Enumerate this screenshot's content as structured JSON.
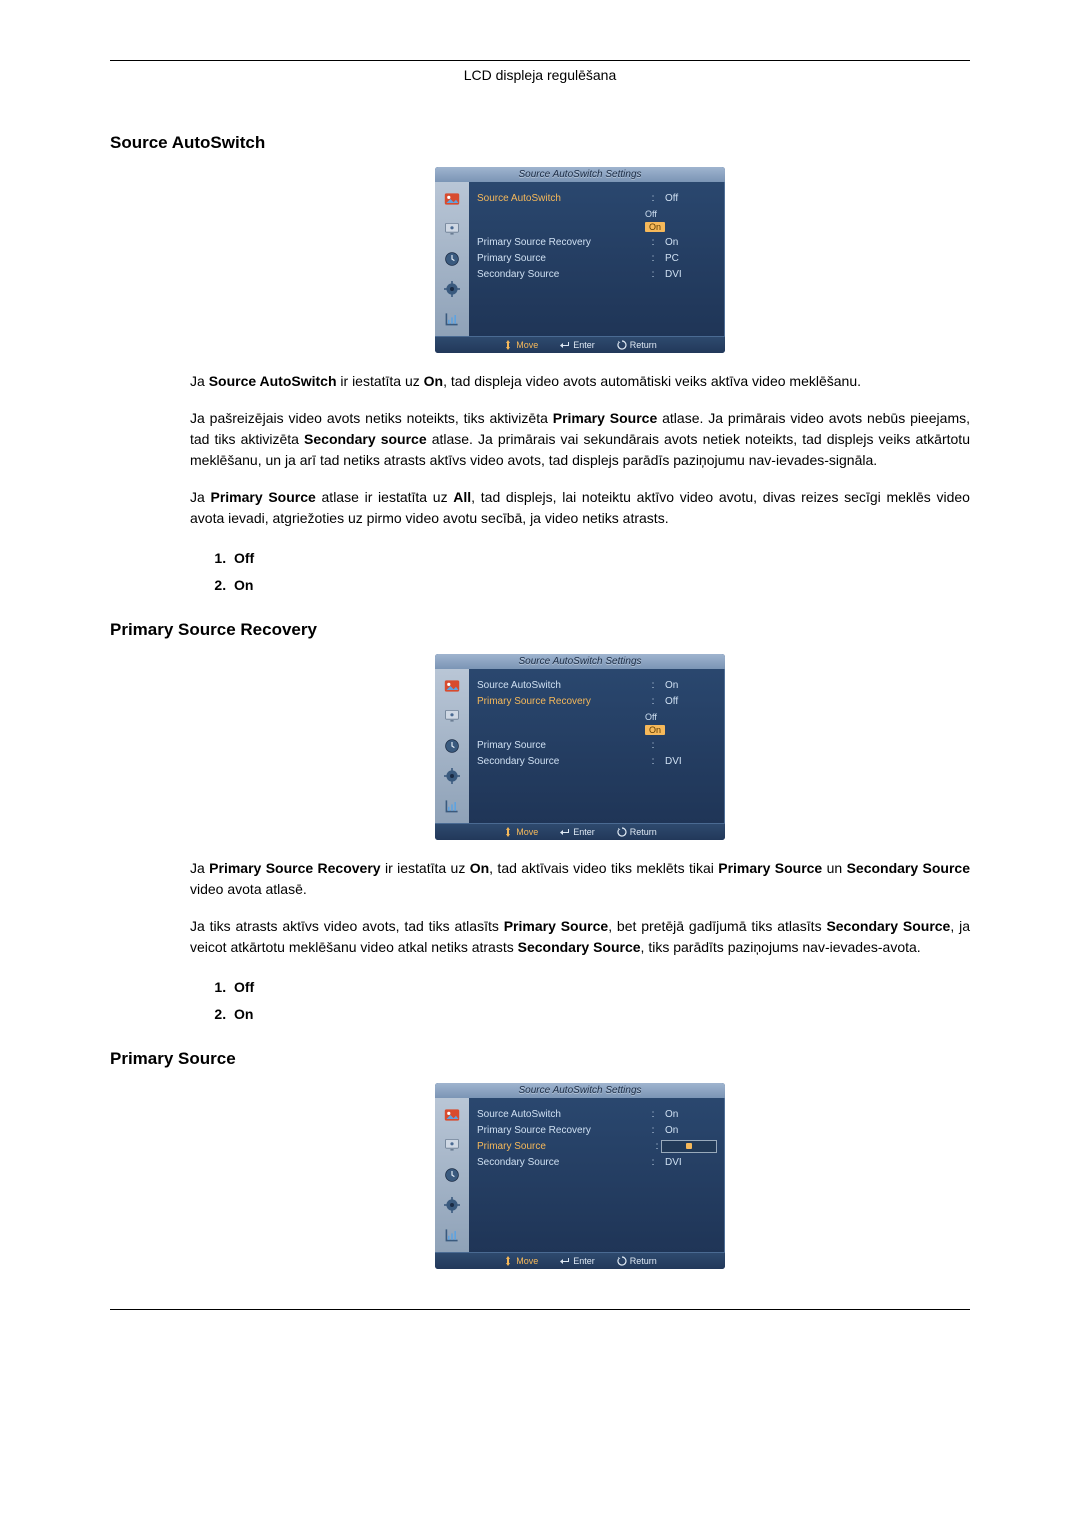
{
  "header_title": "LCD displeja regulēšana",
  "sections": [
    {
      "title": "Source AutowSwitch",
      "title_display": "Source AutoSwitch",
      "osd": {
        "title": "Source AutoSwitch Settings",
        "highlight": 0,
        "dropdown_at": 0,
        "dropdown": [
          "Off",
          "On"
        ],
        "selected_drop": 1,
        "box_at": null,
        "rows": [
          {
            "label": "Source AutoSwitch",
            "value": "Off"
          },
          {
            "label": "Primary Source Recovery",
            "value": "On"
          },
          {
            "label": "Primary Source",
            "value": "PC"
          },
          {
            "label": "Secondary Source",
            "value": "DVI"
          }
        ]
      },
      "paragraphs": [
        {
          "pre": "Ja ",
          "b1": "Source AutoSwitch",
          "mid": " ir iestatīta uz ",
          "b2": "On",
          "post": ", tad displeja video avots automātiski veiks aktīva video meklēšanu."
        },
        {
          "text": "Ja pašreizējais video avots netiks noteikts, tiks aktivizēta ",
          "b1": "Primary Source",
          "mid": " atlase. Ja primārais video avots nebūs pieejams, tad tiks aktivizēta ",
          "b2": "Secondary source",
          "post": " atlase. Ja primārais vai sekundārais avots netiek noteikts, tad displejs veiks atkārtotu meklēšanu, un ja arī tad netiks atrasts aktīvs video avots, tad displejs parādīs paziņojumu nav-ievades-signāla."
        },
        {
          "pre": "Ja ",
          "b1": "Primary Source",
          "mid": " atlase ir iestatīta uz ",
          "b2": "All",
          "post": ", tad displejs, lai noteiktu aktīvo video avotu, divas reizes secīgi meklēs video avota ievadi, atgriežoties uz pirmo video avotu secībā, ja video netiks atrasts."
        }
      ],
      "list": [
        "Off",
        "On"
      ]
    },
    {
      "title_display": "Primary Source Recovery",
      "osd": {
        "title": "Source AutoSwitch Settings",
        "highlight": 1,
        "dropdown_at": 1,
        "dropdown": [
          "Off",
          "On"
        ],
        "selected_drop": 1,
        "box_at": null,
        "rows": [
          {
            "label": "Source AutoSwitch",
            "value": "On"
          },
          {
            "label": "Primary Source Recovery",
            "value": "Off"
          },
          {
            "label": "Primary Source",
            "value": ""
          },
          {
            "label": "Secondary Source",
            "value": "DVI"
          }
        ]
      },
      "paragraphs": [
        {
          "pre": "Ja ",
          "b1": "Primary Source Recovery",
          "mid": " ir iestatīta uz ",
          "b2": "On",
          "post_pre": ", tad aktīvais video tiks meklēts tikai ",
          "b3": "Primary Source",
          "post_mid": " un ",
          "b4": "Secondary Source",
          "post_end": " video avota atlasē."
        },
        {
          "text": "Ja tiks atrasts aktīvs video avots, tad tiks atlasīts ",
          "b1": "Primary Source",
          "mid": ", bet pretējā gadījumā tiks atlasīts ",
          "b2": "Secondary Source",
          "post_pre": ", ja veicot atkārtotu meklēšanu video atkal netiks atrasts ",
          "b3": "Secondary Source",
          "post_end": ", tiks parādīts paziņojums nav-ievades-avota."
        }
      ],
      "list": [
        "Off",
        "On"
      ]
    },
    {
      "title_display": "Primary Source",
      "osd": {
        "title": "Source AutoSwitch Settings",
        "highlight": 2,
        "dropdown_at": null,
        "box_at": 2,
        "rows": [
          {
            "label": "Source AutoSwitch",
            "value": "On"
          },
          {
            "label": "Primary Source Recovery",
            "value": "On"
          },
          {
            "label": "Primary Source",
            "value": ""
          },
          {
            "label": "Secondary Source",
            "value": "DVI"
          }
        ]
      }
    }
  ],
  "footer": {
    "move": "Move",
    "enter": "Enter",
    "return": "Return"
  },
  "icons": [
    "picture",
    "screen",
    "clock",
    "gear",
    "chart"
  ]
}
